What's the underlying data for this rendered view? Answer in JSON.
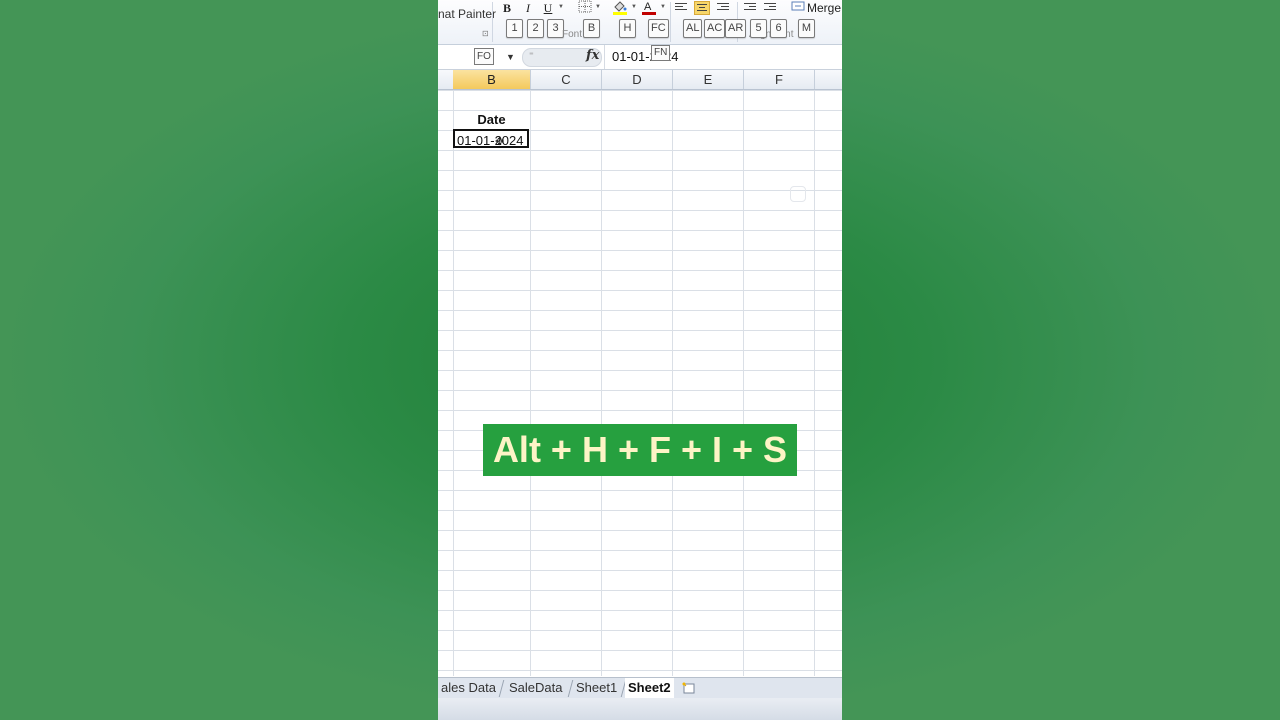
{
  "ribbon": {
    "clipboard_text": "nat Painter",
    "bold_label": "B",
    "italic_label": "I",
    "underline_label": "U",
    "font_group_label": "Font",
    "alignment_group_label": "Alignment",
    "merge_label": "Merge",
    "keytips": {
      "bold": "1",
      "italic": "2",
      "underline": "3",
      "border": "B",
      "fill": "H",
      "font_color": "FC",
      "align_left": "AL",
      "align_center": "AC",
      "align_right": "AR",
      "decrease_indent": "5",
      "increase_indent": "6",
      "merge": "M"
    },
    "font_color_accent": "#c00000",
    "fill_color_accent": "#ffff00"
  },
  "formula_bar": {
    "name_box_keytip": "FO",
    "formula_keytip": "FN",
    "fx_label": "fx",
    "value": "01-01-2024"
  },
  "columns": [
    "B",
    "C",
    "D",
    "E",
    "F"
  ],
  "selected_column": "B",
  "cells": {
    "b_header": "Date",
    "b_value": "01-01-2024"
  },
  "shortcut_text": "Alt + H + F + I + S",
  "shortcut_bg": "#26a03f",
  "shortcut_fg": "#fdf4c6",
  "sheet_tabs": [
    {
      "label": "ales Data",
      "active": false
    },
    {
      "label": "SaleData",
      "active": false
    },
    {
      "label": "Sheet1",
      "active": false
    },
    {
      "label": "Sheet2",
      "active": true
    }
  ],
  "background_color": "#2b8a45"
}
